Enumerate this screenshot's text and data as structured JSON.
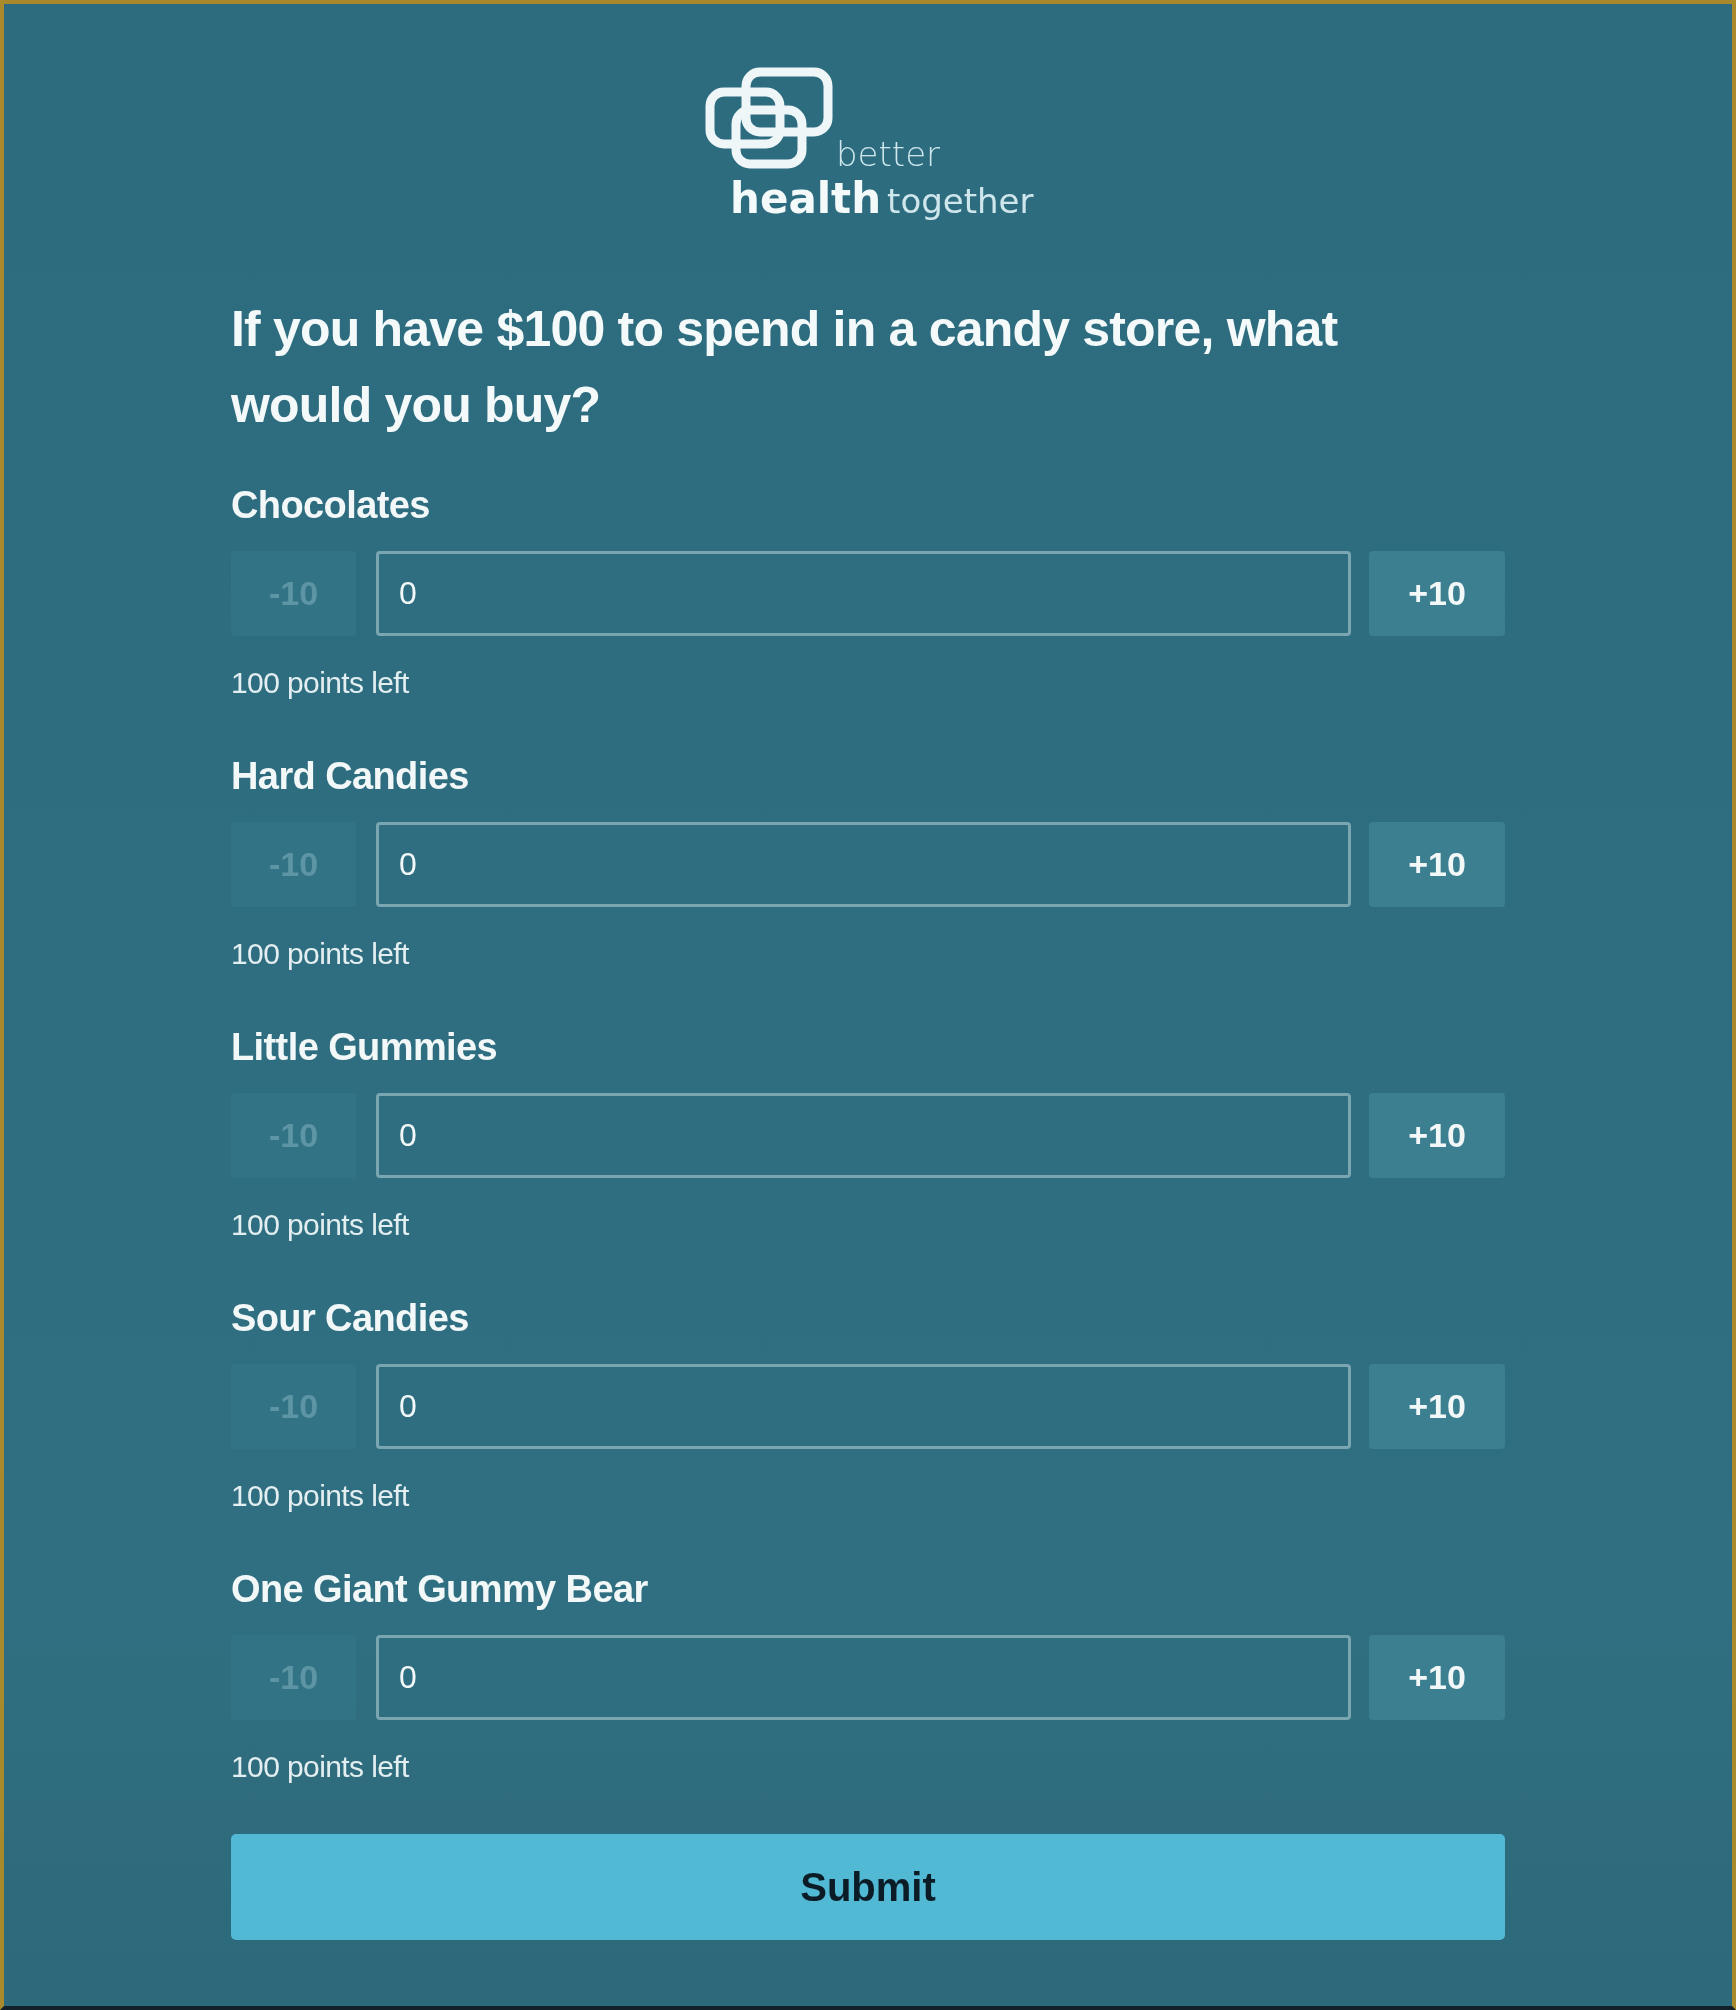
{
  "brand": {
    "top": "better",
    "bold": "health",
    "rest": "together"
  },
  "question": "If you have $100 to spend in a candy store, what would you buy?",
  "items": [
    {
      "label": "Chocolates",
      "minus": "-10",
      "minus_disabled": true,
      "value": "0",
      "plus": "+10",
      "plus_disabled": false,
      "remaining": "100 points left"
    },
    {
      "label": "Hard Candies",
      "minus": "-10",
      "minus_disabled": true,
      "value": "0",
      "plus": "+10",
      "plus_disabled": false,
      "remaining": "100 points left"
    },
    {
      "label": "Little Gummies",
      "minus": "-10",
      "minus_disabled": true,
      "value": "0",
      "plus": "+10",
      "plus_disabled": false,
      "remaining": "100 points left"
    },
    {
      "label": "Sour Candies",
      "minus": "-10",
      "minus_disabled": true,
      "value": "0",
      "plus": "+10",
      "plus_disabled": false,
      "remaining": "100 points left"
    },
    {
      "label": "One Giant Gummy Bear",
      "minus": "-10",
      "minus_disabled": true,
      "value": "0",
      "plus": "+10",
      "plus_disabled": false,
      "remaining": "100 points left"
    }
  ],
  "submit": "Submit"
}
